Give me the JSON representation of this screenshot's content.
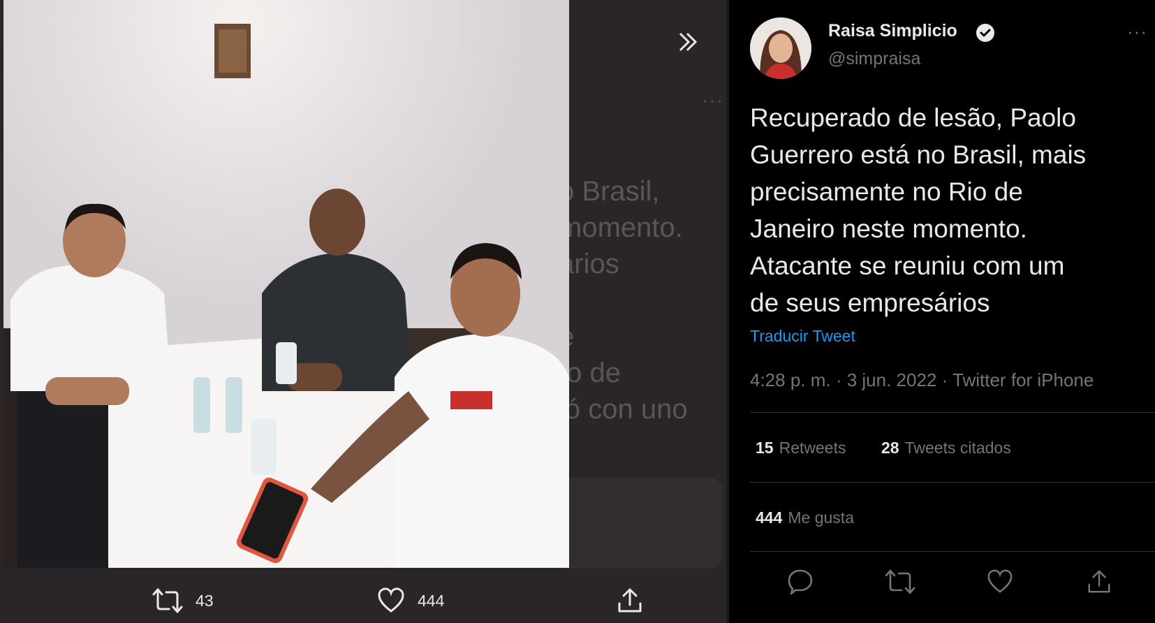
{
  "background_text": {
    "lines": [
      "o Brasil,",
      "momento.",
      "ários",
      "",
      "e",
      "ío de",
      "ió con uno"
    ]
  },
  "media": {
    "retweet_count": "43",
    "like_count": "444"
  },
  "tweet": {
    "author_name": "Raisa Simplicio",
    "author_handle": "@simpraisa",
    "text_lines": [
      "Recuperado de lesão, Paolo",
      "Guerrero está no Brasil, mais",
      "precisamente no Rio de",
      "Janeiro neste momento.",
      "Atacante se reuniu com um",
      "de seus empresários"
    ],
    "translate_label": "Traducir Tweet",
    "meta": "4:28 p. m. · 3 jun. 2022 · Twitter for iPhone",
    "stats": {
      "retweets_value": "15",
      "retweets_label": "Retweets",
      "quotes_value": "28",
      "quotes_label": "Tweets citados",
      "likes_value": "444",
      "likes_label": "Me gusta"
    }
  },
  "icons": [
    "next-icon",
    "retweet-icon",
    "heart-icon",
    "share-icon",
    "verified-icon",
    "more-icon",
    "reply-icon"
  ],
  "colors": {
    "link": "#1d9bf0",
    "secondary_text": "#71767b",
    "primary_text": "#e7e9ea",
    "viewer_bg": "#2a2627"
  }
}
